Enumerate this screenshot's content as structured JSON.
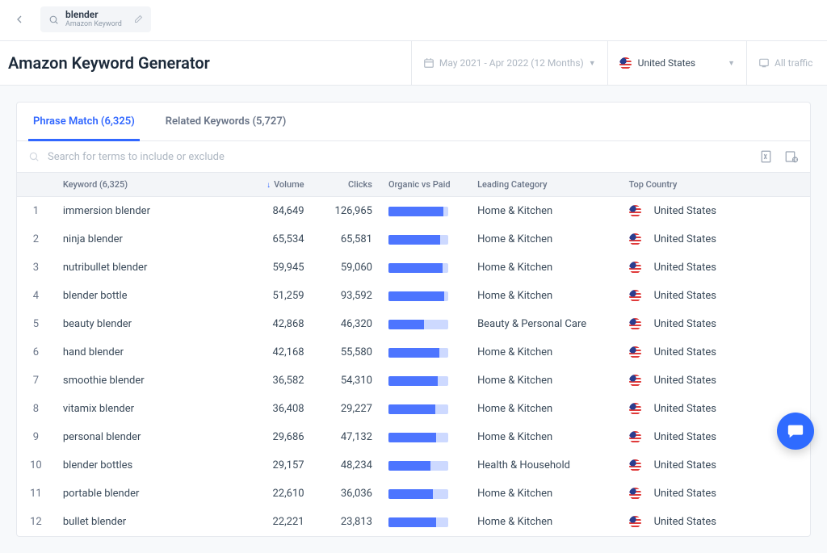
{
  "search_chip": {
    "keyword": "blender",
    "subtitle": "Amazon Keyword"
  },
  "page_title": "Amazon Keyword Generator",
  "date_range": "May 2021 - Apr 2022 (12 Months)",
  "country_selector": "United States",
  "traffic_selector": "All traffic",
  "tabs": [
    {
      "label": "Phrase Match (6,325)",
      "active": true
    },
    {
      "label": "Related Keywords (5,727)",
      "active": false
    }
  ],
  "filter_placeholder": "Search for terms to include or exclude",
  "columns": {
    "keyword": "Keyword (6,325)",
    "volume": "Volume",
    "clicks": "Clicks",
    "organic_paid": "Organic vs Paid",
    "leading_category": "Leading Category",
    "top_country": "Top Country"
  },
  "rows": [
    {
      "idx": "1",
      "keyword": "immersion blender",
      "volume": "84,649",
      "clicks": "126,965",
      "organic_pct": 92,
      "category": "Home & Kitchen",
      "country": "United States"
    },
    {
      "idx": "2",
      "keyword": "ninja blender",
      "volume": "65,534",
      "clicks": "65,581",
      "organic_pct": 86,
      "category": "Home & Kitchen",
      "country": "United States"
    },
    {
      "idx": "3",
      "keyword": "nutribullet blender",
      "volume": "59,945",
      "clicks": "59,060",
      "organic_pct": 90,
      "category": "Home & Kitchen",
      "country": "United States"
    },
    {
      "idx": "4",
      "keyword": "blender bottle",
      "volume": "51,259",
      "clicks": "93,592",
      "organic_pct": 94,
      "category": "Home & Kitchen",
      "country": "United States"
    },
    {
      "idx": "5",
      "keyword": "beauty blender",
      "volume": "42,868",
      "clicks": "46,320",
      "organic_pct": 60,
      "category": "Beauty & Personal Care",
      "country": "United States"
    },
    {
      "idx": "6",
      "keyword": "hand blender",
      "volume": "42,168",
      "clicks": "55,580",
      "organic_pct": 85,
      "category": "Home & Kitchen",
      "country": "United States"
    },
    {
      "idx": "7",
      "keyword": "smoothie blender",
      "volume": "36,582",
      "clicks": "54,310",
      "organic_pct": 82,
      "category": "Home & Kitchen",
      "country": "United States"
    },
    {
      "idx": "8",
      "keyword": "vitamix blender",
      "volume": "36,408",
      "clicks": "29,227",
      "organic_pct": 78,
      "category": "Home & Kitchen",
      "country": "United States"
    },
    {
      "idx": "9",
      "keyword": "personal blender",
      "volume": "29,686",
      "clicks": "47,132",
      "organic_pct": 80,
      "category": "Home & Kitchen",
      "country": "United States"
    },
    {
      "idx": "10",
      "keyword": "blender bottles",
      "volume": "29,157",
      "clicks": "48,234",
      "organic_pct": 70,
      "category": "Health & Household",
      "country": "United States"
    },
    {
      "idx": "11",
      "keyword": "portable blender",
      "volume": "22,610",
      "clicks": "36,036",
      "organic_pct": 75,
      "category": "Home & Kitchen",
      "country": "United States"
    },
    {
      "idx": "12",
      "keyword": "bullet blender",
      "volume": "22,221",
      "clicks": "23,813",
      "organic_pct": 80,
      "category": "Home & Kitchen",
      "country": "United States"
    }
  ]
}
